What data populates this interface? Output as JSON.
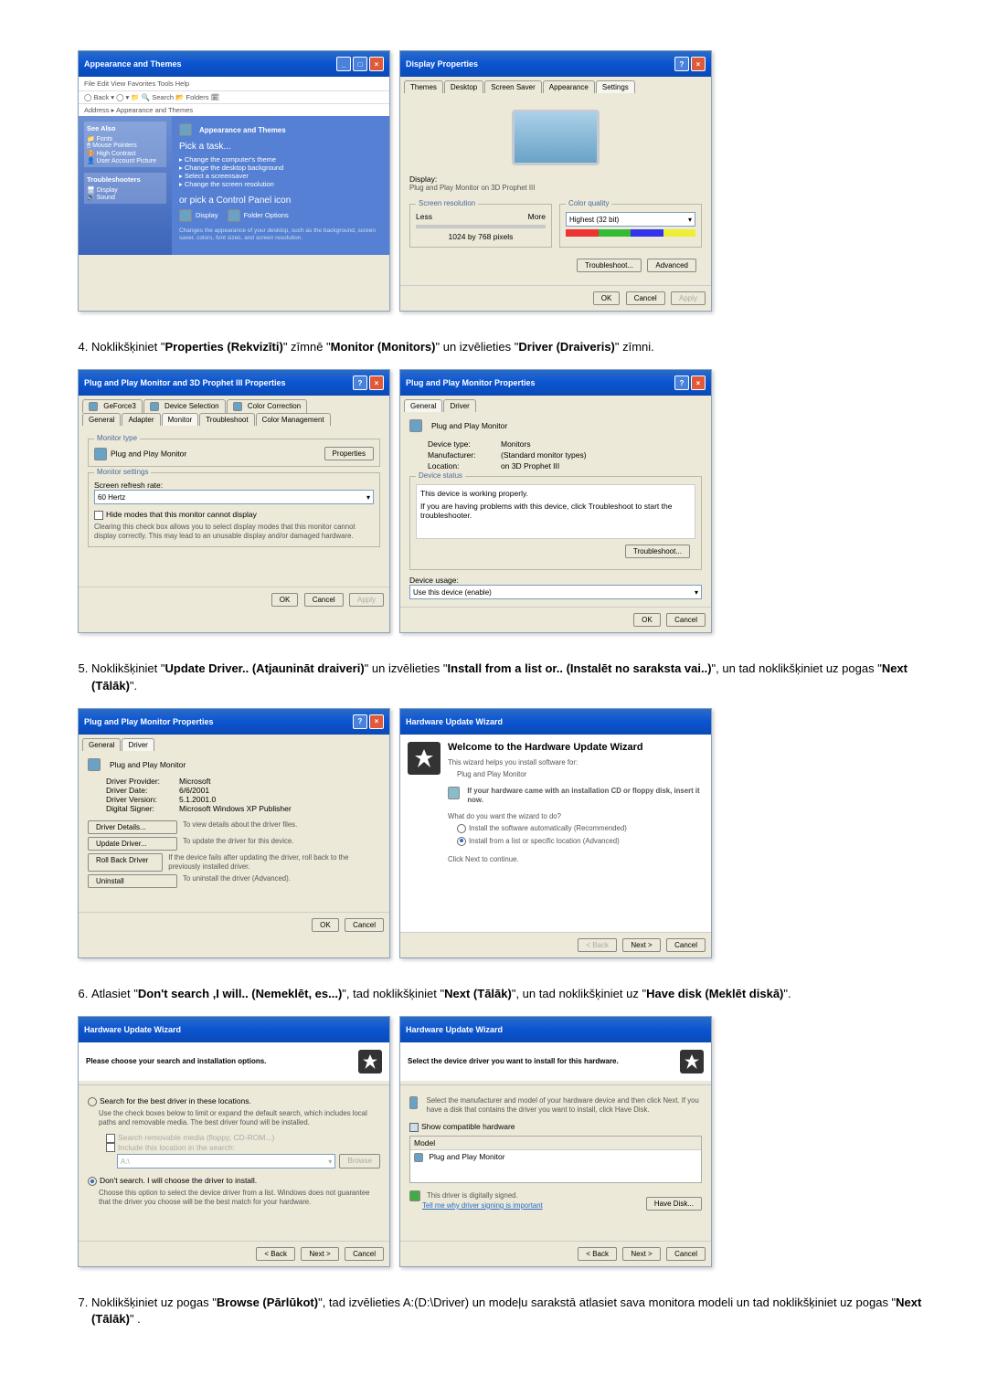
{
  "steps": {
    "s4": "Noklikšķiniet \"Properties (Rekvizīti)\" zīmnē \"Monitor (Monitors)\" un izvēlieties \"Driver (Draiveris)\" zīmni.",
    "s5": "Noklikšķiniet \"Update Driver.. (Atjaunināt draiveri)\" un izvēlieties \"Install from a list or.. (Instalēt no saraksta vai..)\", un tad noklikšķiniet uz pogas \"Next (Tālāk)\".",
    "s6": "Atlasiet \"Don't search ,I will.. (Nemeklēt, es...)\", tad noklikšķiniet \"Next (Tālāk)\", un tad noklikšķiniet uz \"Have disk (Meklēt diskā)\".",
    "s7": "Noklikšķiniet uz pogas \"Browse (Pārlūkot)\", tad izvēlieties A:(D:\\Driver) un modeļu sarakstā atlasiet sava monitora modeli un tad noklikšķiniet uz pogas \"Next (Tālāk)\" ."
  },
  "row1": {
    "left": {
      "title": "Appearance and Themes",
      "breadcrumb": "Address ▸ Appearance and Themes",
      "box_title": "Appearance and Themes",
      "pick_task": "Pick a task...",
      "tasks": [
        "Change the computer's theme",
        "Change the desktop background",
        "Select a screensaver",
        "Change the screen resolution"
      ],
      "or_pick": "or pick a Control Panel icon",
      "icons": [
        "Display",
        "Folder Options"
      ],
      "seealso": "See Also",
      "troubleshoot": "Troubleshooters"
    },
    "right": {
      "title": "Display Properties",
      "tabs": [
        "Themes",
        "Desktop",
        "Screen Saver",
        "Appearance",
        "Settings"
      ],
      "active": 4,
      "display_label": "Display:",
      "display_value": "Plug and Play Monitor on 3D Prophet III",
      "res_label": "Screen resolution",
      "less": "Less",
      "more": "More",
      "res_val": "1024 by 768 pixels",
      "cq_label": "Color quality",
      "cq_val": "Highest (32 bit)",
      "troubleshoot": "Troubleshoot...",
      "advanced": "Advanced",
      "ok": "OK",
      "cancel": "Cancel",
      "apply": "Apply"
    }
  },
  "row2": {
    "left": {
      "title": "Plug and Play Monitor and 3D Prophet III Properties",
      "tabs_top": [
        "GeForce3",
        "Device Selection",
        "Color Correction"
      ],
      "tabs_bot": [
        "General",
        "Adapter",
        "Monitor",
        "Troubleshoot",
        "Color Management"
      ],
      "active": 2,
      "mon_type_label": "Monitor type",
      "mon_name": "Plug and Play Monitor",
      "properties": "Properties",
      "mon_settings": "Monitor settings",
      "refresh_label": "Screen refresh rate:",
      "refresh": "60 Hertz",
      "hide_modes": "Hide modes that this monitor cannot display",
      "hide_note": "Clearing this check box allows you to select display modes that this monitor cannot display correctly. This may lead to an unusable display and/or damaged hardware.",
      "ok": "OK",
      "cancel": "Cancel",
      "apply": "Apply"
    },
    "right": {
      "title": "Plug and Play Monitor Properties",
      "tabs": [
        "General",
        "Driver"
      ],
      "active": 0,
      "header": "Plug and Play Monitor",
      "devtype_l": "Device type:",
      "devtype": "Monitors",
      "manu_l": "Manufacturer:",
      "manu": "(Standard monitor types)",
      "loc_l": "Location:",
      "loc": "on 3D Prophet III",
      "status_l": "Device status",
      "status1": "This device is working properly.",
      "status2": "If you are having problems with this device, click Troubleshoot to start the troubleshooter.",
      "troubleshoot": "Troubleshoot...",
      "usage_l": "Device usage:",
      "usage": "Use this device (enable)",
      "ok": "OK",
      "cancel": "Cancel"
    }
  },
  "row3": {
    "left": {
      "title": "Plug and Play Monitor Properties",
      "tabs": [
        "General",
        "Driver"
      ],
      "active": 1,
      "header": "Plug and Play Monitor",
      "prov_l": "Driver Provider:",
      "prov": "Microsoft",
      "date_l": "Driver Date:",
      "date": "6/6/2001",
      "ver_l": "Driver Version:",
      "ver": "5.1.2001.0",
      "sign_l": "Digital Signer:",
      "sign": "Microsoft Windows XP Publisher",
      "dd_btn": "Driver Details...",
      "dd_txt": "To view details about the driver files.",
      "ud_btn": "Update Driver...",
      "ud_txt": "To update the driver for this device.",
      "rb_btn": "Roll Back Driver",
      "rb_txt": "If the device fails after updating the driver, roll back to the previously installed driver.",
      "un_btn": "Uninstall",
      "un_txt": "To uninstall the driver (Advanced).",
      "ok": "OK",
      "cancel": "Cancel"
    },
    "right": {
      "title": "Hardware Update Wizard",
      "welcome": "Welcome to the Hardware Update Wizard",
      "helps": "This wizard helps you install software for:",
      "device": "Plug and Play Monitor",
      "cd": "If your hardware came with an installation CD or floppy disk, insert it now.",
      "what": "What do you want the wizard to do?",
      "r1": "Install the software automatically (Recommended)",
      "r2": "Install from a list or specific location (Advanced)",
      "click": "Click Next to continue.",
      "back": "< Back",
      "next": "Next >",
      "cancel": "Cancel"
    }
  },
  "row4": {
    "left": {
      "title": "Hardware Update Wizard",
      "head": "Please choose your search and installation options.",
      "r1": "Search for the best driver in these locations.",
      "r1_note": "Use the check boxes below to limit or expand the default search, which includes local paths and removable media. The best driver found will be installed.",
      "c1": "Search removable media (floppy, CD-ROM...)",
      "c2": "Include this location in the search:",
      "path": "A:\\",
      "browse": "Browse",
      "r2": "Don't search. I will choose the driver to install.",
      "r2_note": "Choose this option to select the device driver from a list. Windows does not guarantee that the driver you choose will be the best match for your hardware.",
      "back": "< Back",
      "next": "Next >",
      "cancel": "Cancel"
    },
    "right": {
      "title": "Hardware Update Wizard",
      "head": "Select the device driver you want to install for this hardware.",
      "sub": "Select the manufacturer and model of your hardware device and then click Next. If you have a disk that contains the driver you want to install, click Have Disk.",
      "show": "Show compatible hardware",
      "model_l": "Model",
      "model": "Plug and Play Monitor",
      "signed": "This driver is digitally signed.",
      "tell": "Tell me why driver signing is important",
      "havedisk": "Have Disk...",
      "back": "< Back",
      "next": "Next >",
      "cancel": "Cancel"
    }
  }
}
